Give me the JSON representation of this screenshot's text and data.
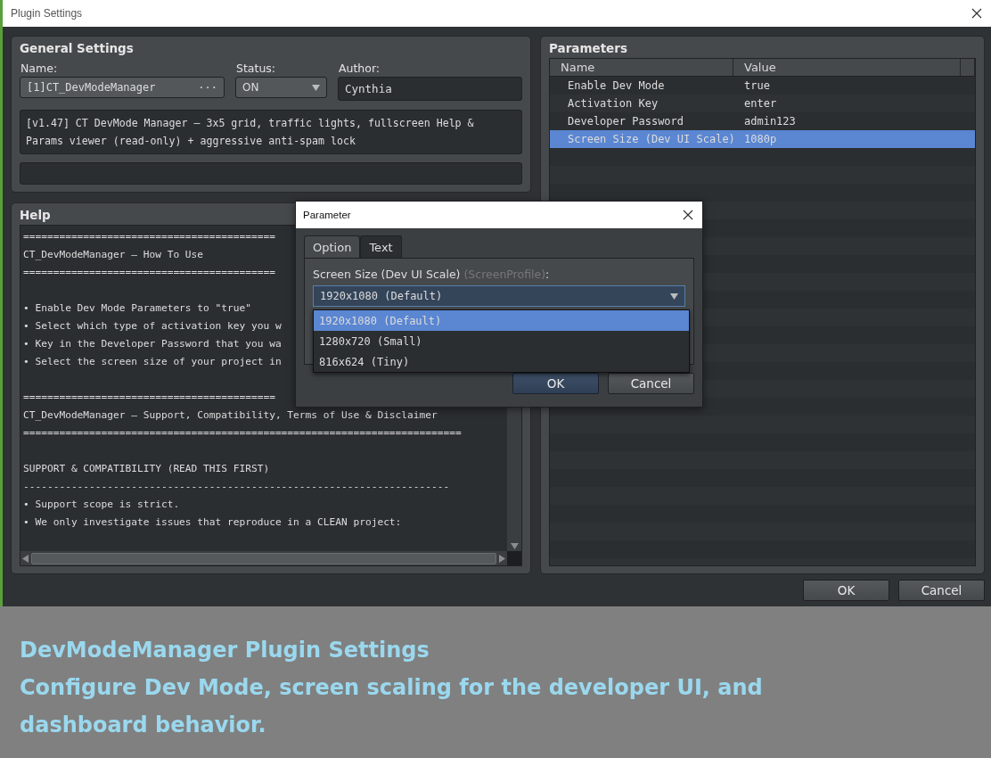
{
  "window": {
    "title": "Plugin Settings"
  },
  "general_settings": {
    "title": "General Settings",
    "name_label": "Name:",
    "name_value": "[1]CT_DevModeManager",
    "browse_button": "···",
    "status_label": "Status:",
    "status_value": "ON",
    "author_label": "Author:",
    "author_value": "Cynthia",
    "description": "[v1.47] CT DevMode Manager — 3x5 grid, traffic lights, fullscreen Help & Params viewer (read-only) + aggressive anti-spam lock"
  },
  "help": {
    "title": "Help",
    "lines": [
      {
        "kind": "text",
        "text": "=========================================="
      },
      {
        "kind": "text",
        "text": "CT_DevModeManager — How To Use"
      },
      {
        "kind": "text",
        "text": "=========================================="
      },
      {
        "kind": "blank"
      },
      {
        "kind": "text",
        "text": "• Enable Dev Mode Parameters to \"true\""
      },
      {
        "kind": "text",
        "text": "• Select which type of activation key you w"
      },
      {
        "kind": "text",
        "text": "• Key in the Developer Password that you wa"
      },
      {
        "kind": "text",
        "text": "• Select the screen size of your project in"
      },
      {
        "kind": "blank"
      },
      {
        "kind": "text",
        "text": "=========================================="
      },
      {
        "kind": "text",
        "text": "CT_DevModeManager — Support, Compatibility, Terms of Use & Disclaimer"
      },
      {
        "kind": "text",
        "text": "========================================================================="
      },
      {
        "kind": "blank"
      },
      {
        "kind": "text",
        "text": "SUPPORT & COMPATIBILITY (READ THIS FIRST)"
      },
      {
        "kind": "text",
        "text": "-----------------------------------------------------------------------"
      },
      {
        "kind": "text",
        "text": "• Support scope is strict."
      },
      {
        "kind": "text",
        "text": "• We only investigate issues that reproduce in a CLEAN project:"
      }
    ]
  },
  "parameters": {
    "title": "Parameters",
    "columns": [
      "Name",
      "Value"
    ],
    "rows": [
      {
        "name": "Enable Dev Mode",
        "value": "true",
        "selected": false
      },
      {
        "name": "Activation Key",
        "value": "enter",
        "selected": false
      },
      {
        "name": "Developer Password",
        "value": "admin123",
        "selected": false
      },
      {
        "name": "Screen Size (Dev UI Scale)",
        "value": "1080p",
        "selected": true
      }
    ]
  },
  "buttons": [
    {
      "label": "OK",
      "default": false
    },
    {
      "label": "Cancel",
      "default": false
    }
  ],
  "dialog": {
    "title": "Parameter",
    "tabs": [
      {
        "label": "Option",
        "selected": true
      },
      {
        "label": "Text",
        "selected": false
      }
    ],
    "field_label": "Screen Size (Dev UI Scale)",
    "field_key": "(ScreenProfile)",
    "field_suffix": ":",
    "combo_value": "1920x1080 (Default)",
    "options": [
      {
        "label": "1920x1080 (Default)",
        "selected": true
      },
      {
        "label": "1280x720 (Small)",
        "selected": false
      },
      {
        "label": "816x624 (Tiny)",
        "selected": false
      }
    ],
    "buttons": [
      {
        "label": "OK",
        "default": true
      },
      {
        "label": "Cancel",
        "default": false
      }
    ]
  },
  "caption": {
    "title": "DevModeManager Plugin Settings",
    "text": "Configure Dev Mode, screen scaling for the developer UI, and dashboard behavior."
  }
}
